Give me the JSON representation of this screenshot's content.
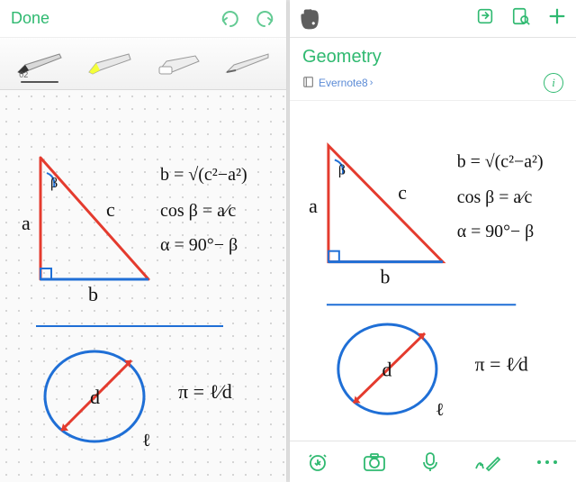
{
  "left": {
    "done_label": "Done",
    "pen_size_label": "02"
  },
  "right": {
    "note_title": "Geometry",
    "notebook_name": "Evernote8"
  },
  "drawing": {
    "triangle": {
      "side_a": "a",
      "side_b": "b",
      "side_c": "c",
      "angle_beta": "β"
    },
    "formulas": {
      "line1": "b = √(c²−a²)",
      "line2": "cos β = a⁄c",
      "line3": "α = 90°− β"
    },
    "circle": {
      "diameter_label": "d",
      "perimeter_label": "ℓ",
      "pi_formula": "π = ℓ⁄d"
    }
  }
}
